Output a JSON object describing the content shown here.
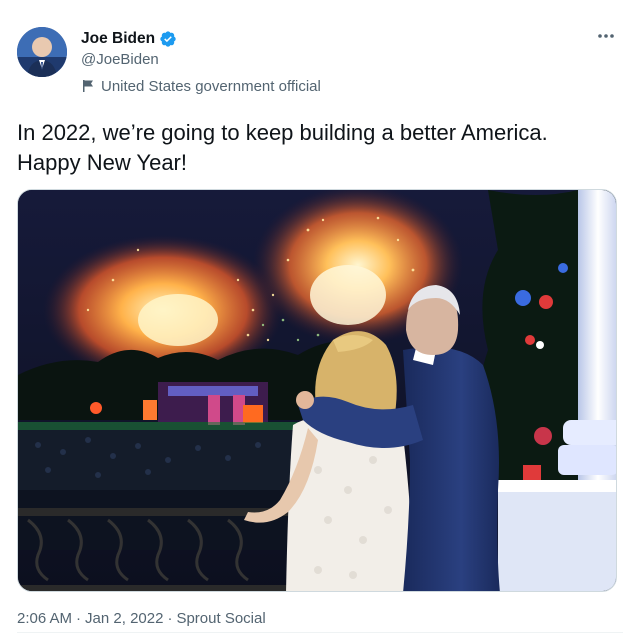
{
  "author": {
    "name": "Joe Biden",
    "handle": "@JoeBiden",
    "label": "United States government official",
    "verified_icon": "verified-badge-icon",
    "label_icon": "flag-icon"
  },
  "tweet": {
    "text_line1": "In 2022, we’re going to keep building a better America.",
    "text_line2": "Happy New Year!"
  },
  "meta": {
    "time": "2:06 AM",
    "separator1": "·",
    "date": "Jan 2, 2022",
    "separator2": "·",
    "source": "Sprout Social"
  },
  "colors": {
    "verified": "#1d9bf0",
    "secondary_text": "#536471",
    "primary_text": "#0f1419"
  }
}
